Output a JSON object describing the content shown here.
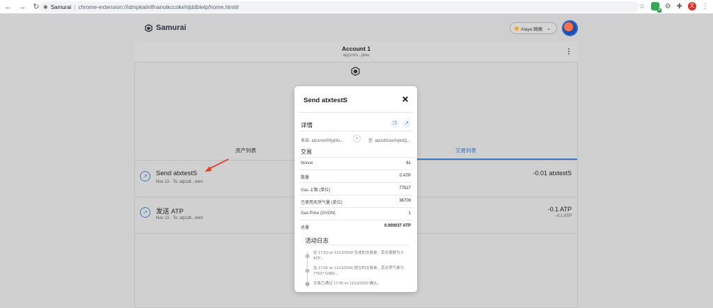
{
  "browser": {
    "tab_title": "Samurai",
    "separator": "|",
    "url": "chrome-extension://idmpkaiinlfnanoikccokehijddblelp/home.html#",
    "ext_badge_count": "6",
    "profile_initial": "文"
  },
  "app": {
    "brand": "Samurai",
    "network_label": "Alaya 网络"
  },
  "account": {
    "name": "Account 1",
    "address_short": "atp1mm...jlww"
  },
  "tabs": {
    "assets": "资产列表",
    "transactions": "交易列表"
  },
  "transactions": [
    {
      "title": "Send atxtestS",
      "subtitle": "Nov 13 · To: atp1dt...mkrr",
      "amount": "-0.01 atxtestS",
      "amount_secondary": ""
    },
    {
      "title": "发送 ATP",
      "subtitle": "Nov 13 · To: atp1dt...mkrr",
      "amount": "-0.1 ATP",
      "amount_secondary": "-0.1 ATP"
    }
  ],
  "modal": {
    "title": "Send atxtestS",
    "details_label": "详情",
    "from": "来自: atp1mm09yjr8v...",
    "to": "至: atp1dt2wx0xjkd2j...",
    "tx_section": "交易",
    "rows": [
      {
        "key": "Nonce",
        "value": "61"
      },
      {
        "key": "数量",
        "value": "0 ATP"
      },
      {
        "key": "Gas 上限 (单位)",
        "value": "77527"
      },
      {
        "key": "已使用天然气量 (单位)",
        "value": "36709"
      },
      {
        "key": "Gas Price (GVON)",
        "value": "1"
      },
      {
        "key": "总量",
        "value": "0.000037 ATP"
      }
    ],
    "log_title": "活动日志",
    "log": [
      "在 17:03 on 11/13/2020 生成的交易单，其交易额为 0 ATP 。",
      "在 17:05 on 11/13/2020 提交的交易单，其天然气费为 77527 GWEI 。",
      "交易已通过 17:05 on 11/13/2020 确认。"
    ]
  },
  "colors": {
    "accent": "#3a78c9",
    "overlay_gray": "#cfcfcf",
    "arrow_red": "#e0452b"
  }
}
